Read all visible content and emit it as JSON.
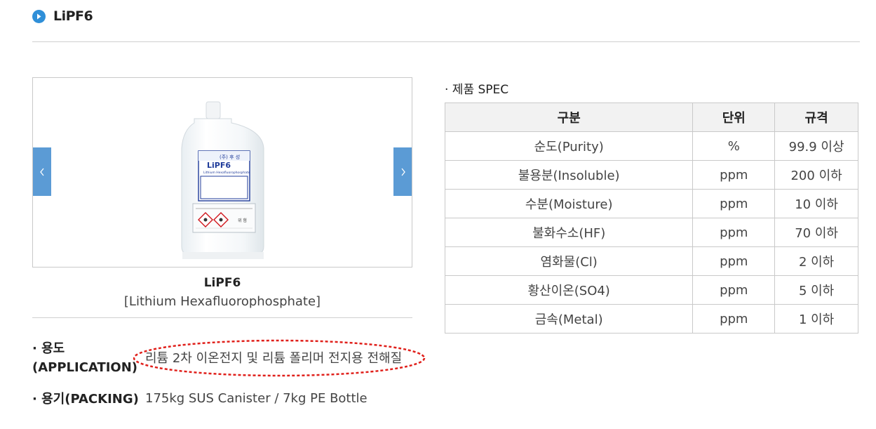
{
  "header": {
    "title": "LiPF6"
  },
  "slider": {
    "label": {
      "company": "(주) 후 성",
      "product": "LiPF6",
      "subtitle": "Lithium Hexafluorophosphate",
      "warning": "위 험"
    }
  },
  "product": {
    "name": "LiPF6",
    "subtitle": "[Lithium Hexafluorophosphate]"
  },
  "info": {
    "application_label_line1": "· 용도",
    "application_label_line2": "(APPLICATION)",
    "application_value": "리튬 2차 이온전지 및 리튬 폴리머 전지용 전해질",
    "packing_label": "· 용기(PACKING)",
    "packing_value": "175kg SUS Canister / 7kg PE Bottle"
  },
  "spec": {
    "heading": "· 제품 SPEC",
    "headers": [
      "구분",
      "단위",
      "규격"
    ],
    "rows": [
      [
        "순도(Purity)",
        "%",
        "99.9 이상"
      ],
      [
        "불용분(Insoluble)",
        "ppm",
        "200 이하"
      ],
      [
        "수분(Moisture)",
        "ppm",
        "10 이하"
      ],
      [
        "불화수소(HF)",
        "ppm",
        "70 이하"
      ],
      [
        "염화물(Cl)",
        "ppm",
        "2 이하"
      ],
      [
        "황산이온(SO4)",
        "ppm",
        "5 이하"
      ],
      [
        "금속(Metal)",
        "ppm",
        "1 이하"
      ]
    ]
  },
  "colors": {
    "accent": "#2f8fd8",
    "slider_button": "#5b9bd5",
    "highlight": "#e0201b"
  }
}
